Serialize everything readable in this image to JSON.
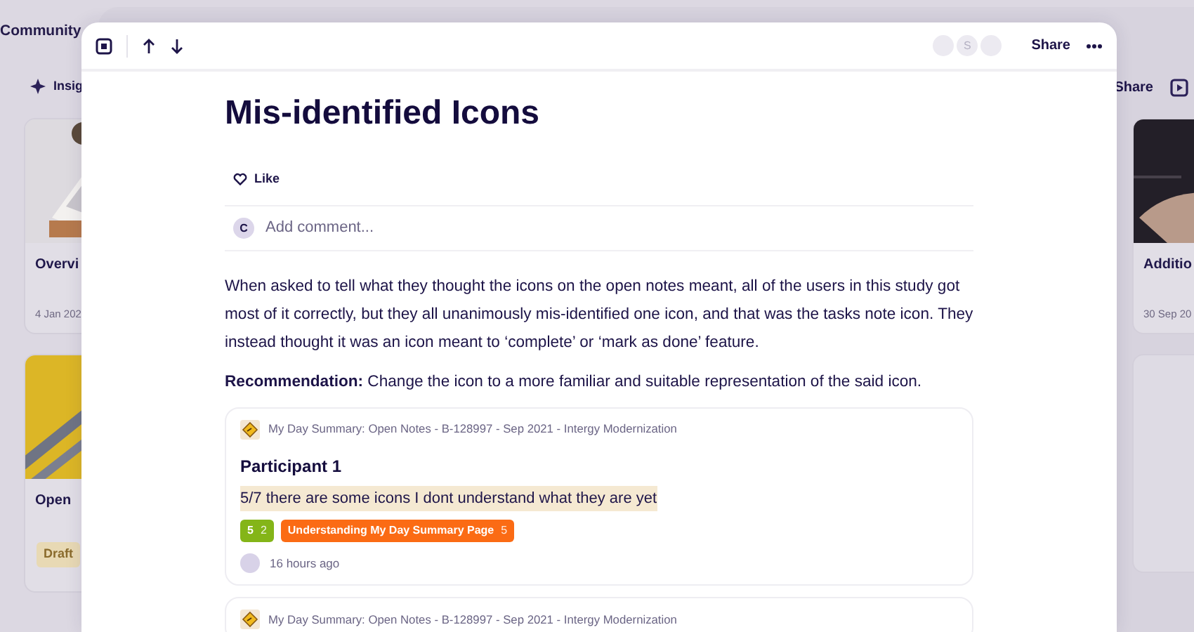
{
  "background": {
    "app_title": "Community",
    "tab": "Insig",
    "share": "Share",
    "cards_left": [
      {
        "title": "Overvi",
        "date": "4 Jan 202"
      },
      {
        "title": "Open",
        "badge": "Draft"
      }
    ],
    "cards_right": [
      {
        "title": "Additio",
        "date": "30 Sep 20"
      }
    ]
  },
  "modal": {
    "toolbar": {
      "avatars": [
        {
          "kind": "blank"
        },
        {
          "kind": "letter",
          "initial": "S"
        },
        {
          "kind": "blank"
        }
      ],
      "share": "Share"
    },
    "title": "Mis-identified Icons",
    "like": "Like",
    "comment": {
      "initial": "C",
      "placeholder": "Add comment..."
    },
    "paragraphs": [
      "When asked to tell what they thought the icons on the open notes meant, all of the users in this study got most of it correctly, but they all unanimously mis-identified one icon, and that was the tasks note icon. They instead thought it was an icon meant to ‘complete’ or ‘mark as done’ feature.",
      "**Recommendation:** Change the icon to a more familiar and suitable representation of the said icon."
    ],
    "highlights": [
      {
        "source": "My Day Summary: Open Notes - B-128997 - Sep 2021 - Intergy Modernization",
        "participant": "Participant 1",
        "quote": "5/7 there are some icons I dont understand what they are yet",
        "tags": [
          {
            "label": "5",
            "count": "2",
            "color": "#84b518"
          },
          {
            "label": "Understanding My Day Summary Page",
            "count": "5",
            "color": "#fb6b14"
          }
        ],
        "time": "16 hours ago"
      },
      {
        "source": "My Day Summary: Open Notes - B-128997 - Sep 2021 - Intergy Modernization"
      }
    ]
  }
}
